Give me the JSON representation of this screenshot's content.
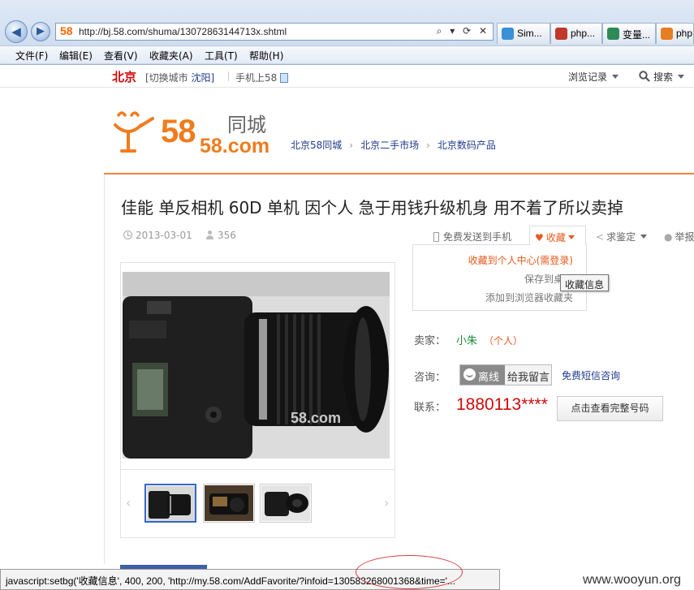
{
  "browser": {
    "address_logo": "58",
    "url": "http://bj.58.com/shuma/13072863144713x.shtml",
    "address_tools": "⌕ ▾ ⟳ ✕",
    "tabs": [
      {
        "label": "Sim...",
        "color": "#3a8fd6"
      },
      {
        "label": "php...",
        "color": "#c0392b"
      },
      {
        "label": "变量...",
        "color": "#2e8b57"
      },
      {
        "label": "php",
        "color": "#e67e22"
      }
    ],
    "menu": [
      "文件(F)",
      "编辑(E)",
      "查看(V)",
      "收藏夹(A)",
      "工具(T)",
      "帮助(H)"
    ],
    "status_text": "javascript:setbg('收藏信息', 400, 200, 'http://my.58.com/AddFavorite/?infoid=130583268001368&time='..."
  },
  "topbar": {
    "city": "北京",
    "switch_prefix": "[切换城市",
    "switch_city": "沈阳]",
    "mobile": "手机上58",
    "history": "浏览记录",
    "search": "搜索"
  },
  "logo": {
    "cn": "同城",
    "en": "58.com"
  },
  "breadcrumb": [
    "北京58同城",
    "北京二手市场",
    "北京数码产品"
  ],
  "post": {
    "title": "佳能 单反相机 60D 单机 因个人 急于用钱升级机身 用不着了所以卖掉",
    "date": "2013-03-01",
    "views": "356"
  },
  "actions": {
    "send_phone": "免费发送到手机",
    "favorite": "收藏",
    "appraise": "求鉴定",
    "report": "举报"
  },
  "fav_menu": {
    "item1": "收藏到个人中心(需登录)",
    "item2": "保存到桌面",
    "item3": "添加到浏览器收藏夹",
    "tooltip": "收藏信息"
  },
  "seller": {
    "seller_label": "卖家：",
    "name": "小朱",
    "type": "（个人）",
    "consult_label": "咨询：",
    "offline": "离线",
    "leave_msg": "给我留言",
    "sms": "免费短信咨询",
    "contact_label": "联系：",
    "phone": "1880113****",
    "full_number": "点击查看完整号码"
  },
  "watermark_photo": "58.com",
  "site_watermark": "www.wooyun.org",
  "colors": {
    "brand_orange": "#f2843a",
    "price_red": "#d10a0a",
    "link_blue": "#1f3a8c"
  }
}
